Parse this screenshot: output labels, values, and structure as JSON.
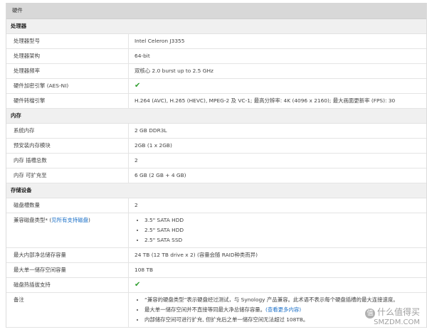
{
  "title": "硬件",
  "sections": {
    "cpu": {
      "header": "处理器",
      "rows": [
        {
          "label": "处理器型号",
          "value": "Intel Celeron J3355"
        },
        {
          "label": "处理器架构",
          "value": "64-bit"
        },
        {
          "label": "处理器频率",
          "value": "双核心 2.0 burst up to 2.5 GHz"
        },
        {
          "label": "硬件加密引擎 (AES-NI)",
          "value": "✔"
        },
        {
          "label": "硬件转檔引擎",
          "value": "H.264 (AVC), H.265 (HEVC), MPEG-2 及 VC-1; 最高分辨率: 4K (4096 x 2160); 最大画面更新率 (FPS): 30"
        }
      ]
    },
    "memory": {
      "header": "内存",
      "rows": [
        {
          "label": "系统内存",
          "value": "2 GB DDR3L"
        },
        {
          "label": "预安装内存模块",
          "value": "2GB (1 x 2GB)"
        },
        {
          "label": "内存 插槽总数",
          "value": "2"
        },
        {
          "label": "内存 可扩充至",
          "value": "6 GB (2 GB + 4 GB)"
        }
      ]
    },
    "storage": {
      "header": "存储设备",
      "bay_count": {
        "label": "磁盘槽数量",
        "value": "2"
      },
      "compat": {
        "label_prefix": "兼容磁盘类型* (",
        "label_link": "见所有支持磁盘",
        "label_suffix": ")",
        "items": [
          "3.5\" SATA HDD",
          "2.5\" SATA HDD",
          "2.5\" SATA SSD"
        ]
      },
      "max_raw": {
        "label": "最大内部净总储存容量",
        "value": "24 TB (12 TB drive x 2) (容量会随 RAID种类而异)"
      },
      "max_volume": {
        "label": "最大单一储存空间容量",
        "value": "108 TB"
      },
      "hot_swap": {
        "label": "磁盘热插拔支持",
        "value": "✔"
      },
      "notes": {
        "label": "备注",
        "item1": "“兼容的硬盘类型”表示硬盘经过测试，与 Synology 产品兼容。此术语不表示每个硬盘插槽的最大连接速度。",
        "item2_prefix": "最大单一储存空间并不直接等同最大净总储存容量。",
        "item2_link": "(查看更多内容)",
        "item3": "内部储存空间可进行扩充, 但扩充后之单一储存空间无法超过 108TB。"
      }
    }
  },
  "watermark": {
    "cn": "什么值得买",
    "en": "SMZDM.COM",
    "logo": "值"
  }
}
